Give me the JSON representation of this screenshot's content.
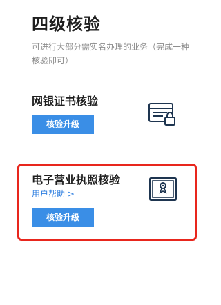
{
  "header": {
    "title": "四级核验",
    "description": "可进行大部分需实名办理的业务（完成一种核验即可）"
  },
  "methods": [
    {
      "name": "网银证书核验",
      "button_label": "核验升级",
      "icon": "bank-card-lock-icon"
    },
    {
      "name": "电子营业执照核验",
      "help_link": "用户帮助 >",
      "button_label": "核验升级",
      "icon": "business-license-icon"
    }
  ],
  "colors": {
    "button_bg": "#3a8ee6",
    "link": "#2f7fe0",
    "highlight_border": "#e8261d",
    "icon_stroke": "#1e3550"
  }
}
